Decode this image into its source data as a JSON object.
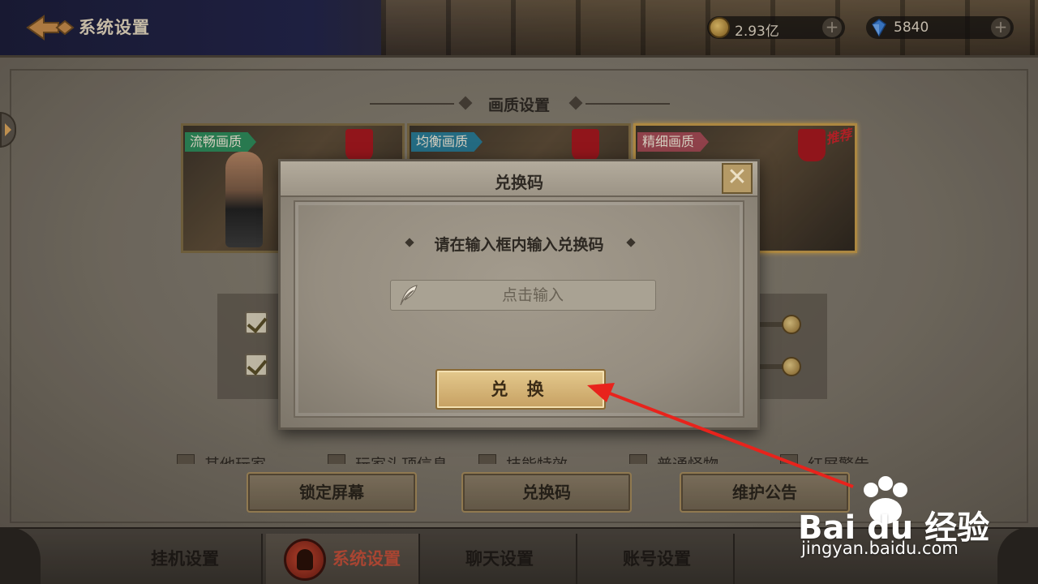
{
  "header": {
    "title": "系统设置",
    "gold": "2.93亿",
    "diamonds": "5840",
    "plus": "+"
  },
  "quality": {
    "section_title": "画质设置",
    "options": [
      {
        "label": "流畅画质",
        "color": "#2e8a5a"
      },
      {
        "label": "均衡画质",
        "color": "#2a7a95"
      },
      {
        "label": "精细画质",
        "color": "#a34a55",
        "badge": "推荐"
      }
    ]
  },
  "partial_options": [
    "其他玩家",
    "玩家头顶信息",
    "技能特效",
    "普通怪物",
    "红屏警告"
  ],
  "actions": {
    "lock_screen": "锁定屏幕",
    "redeem_code": "兑换码",
    "maintenance_notice": "维护公告"
  },
  "tabs": [
    {
      "label": "挂机设置",
      "active": false
    },
    {
      "label": "系统设置",
      "active": true
    },
    {
      "label": "聊天设置",
      "active": false
    },
    {
      "label": "账号设置",
      "active": false
    }
  ],
  "dialog": {
    "title": "兑换码",
    "prompt": "请在输入框内输入兑换码",
    "input_placeholder": "点击输入",
    "confirm": "兑 换",
    "close": "✕"
  },
  "watermark": {
    "brand": "Bai du 经验",
    "url": "jingyan.baidu.com"
  },
  "colors": {
    "annotation_arrow": "#e8231c",
    "accent_gold": "#d4a84f"
  }
}
